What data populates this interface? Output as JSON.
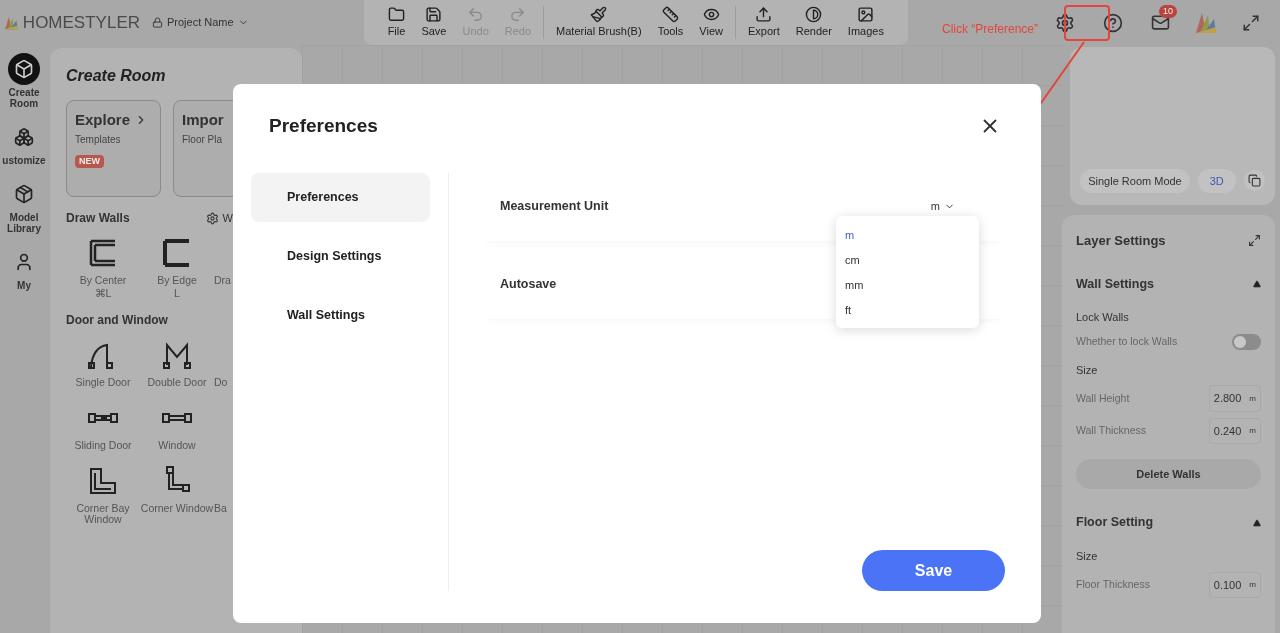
{
  "app": {
    "brand": "HOMESTYLER",
    "project": "Project Name"
  },
  "toolbar": [
    [
      {
        "label": "File",
        "disabled": false
      },
      {
        "label": "Save",
        "disabled": false
      },
      {
        "label": "Undo",
        "disabled": true
      },
      {
        "label": "Redo",
        "disabled": true
      }
    ],
    [
      {
        "label": "Material Brush(B)",
        "disabled": false
      },
      {
        "label": "Tools",
        "disabled": false
      },
      {
        "label": "View",
        "disabled": false
      }
    ],
    [
      {
        "label": "Export",
        "disabled": false
      },
      {
        "label": "Render",
        "disabled": false
      },
      {
        "label": "Images",
        "disabled": false
      }
    ]
  ],
  "notifications": {
    "badge": "10"
  },
  "annotation": {
    "label": "Click “Preference”"
  },
  "nav": [
    {
      "label": "Create Room",
      "selected": true
    },
    {
      "label": "ustomize",
      "selected": false
    },
    {
      "label": "Model Library",
      "selected": false
    },
    {
      "label": "My",
      "selected": false
    }
  ],
  "left_panel": {
    "title": "Create Room",
    "cards": [
      {
        "title": "Explore",
        "subtitle": "Templates",
        "badge": "NEW"
      },
      {
        "title": "Impor",
        "subtitle": "Floor Pla"
      }
    ],
    "sections": [
      {
        "title": "Draw Walls",
        "action": "W",
        "items": [
          {
            "label": "By Center",
            "shortcut": "⌘L"
          },
          {
            "label": "By Edge",
            "shortcut": "L"
          },
          {
            "label": "Dra"
          }
        ]
      },
      {
        "title": "Door and Window",
        "rows": [
          [
            {
              "label": "Single Door"
            },
            {
              "label": "Double Door"
            },
            {
              "label": "Do"
            }
          ],
          [
            {
              "label": "Sliding Door"
            },
            {
              "label": "Window"
            }
          ],
          [
            {
              "label": "Corner Bay Window"
            },
            {
              "label": "Corner Window"
            },
            {
              "label": "Ba"
            }
          ]
        ]
      }
    ]
  },
  "preview": {
    "buttons": [
      {
        "label": "Single Room Mode",
        "selected": false
      },
      {
        "label": "3D",
        "selected": true
      }
    ]
  },
  "layer_settings": {
    "title": "Layer Settings",
    "sections": [
      {
        "title": "Wall Settings",
        "expanded": true,
        "rows": [
          {
            "kind": "heading",
            "label": "Lock Walls"
          },
          {
            "kind": "toggle",
            "label": "Whether to lock Walls",
            "on": false
          },
          {
            "kind": "heading",
            "label": "Size"
          },
          {
            "kind": "number",
            "label": "Wall Height",
            "value": "2.800",
            "unit": "m"
          },
          {
            "kind": "number",
            "label": "Wall Thickness",
            "value": "0.240",
            "unit": "m"
          },
          {
            "kind": "button",
            "label": "Delete Walls"
          }
        ]
      },
      {
        "title": "Floor Setting",
        "expanded": true,
        "rows": [
          {
            "kind": "heading",
            "label": "Size"
          },
          {
            "kind": "number",
            "label": "Floor Thickness",
            "value": "0.100",
            "unit": "m"
          }
        ]
      }
    ]
  },
  "dialog": {
    "title": "Preferences",
    "menu": [
      {
        "label": "Preferences",
        "selected": true
      },
      {
        "label": "Design Settings",
        "selected": false
      },
      {
        "label": "Wall Settings",
        "selected": false
      }
    ],
    "settings": [
      {
        "kind": "select",
        "label": "Measurement Unit",
        "value": "m",
        "open": true,
        "options": [
          {
            "label": "m",
            "selected": true
          },
          {
            "label": "cm",
            "selected": false
          },
          {
            "label": "mm",
            "selected": false
          },
          {
            "label": "ft",
            "selected": false
          }
        ]
      },
      {
        "kind": "plain",
        "label": "Autosave"
      }
    ],
    "save": "Save"
  }
}
